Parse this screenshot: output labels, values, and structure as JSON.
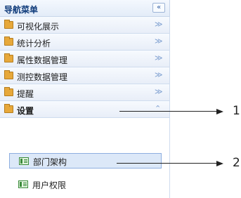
{
  "nav": {
    "title": "导航菜单",
    "collapse_icon": "«",
    "items": [
      {
        "label": "可视化展示",
        "chevron": "≫"
      },
      {
        "label": "统计分析",
        "chevron": "≫"
      },
      {
        "label": "属性数据管理",
        "chevron": "≫"
      },
      {
        "label": "测控数据管理",
        "chevron": "≫"
      },
      {
        "label": "提醒",
        "chevron": "≫"
      },
      {
        "label": "设置",
        "chevron": "⌃",
        "expanded": true
      }
    ],
    "sub_items": [
      {
        "label": "部门架构",
        "selected": true
      },
      {
        "label": "用户权限",
        "selected": false
      }
    ]
  },
  "callouts": [
    "1",
    "2"
  ],
  "colors": {
    "folder": "#e7a83a",
    "selected_bg": "#dce8f8",
    "header_text": "#0e3a7a"
  }
}
